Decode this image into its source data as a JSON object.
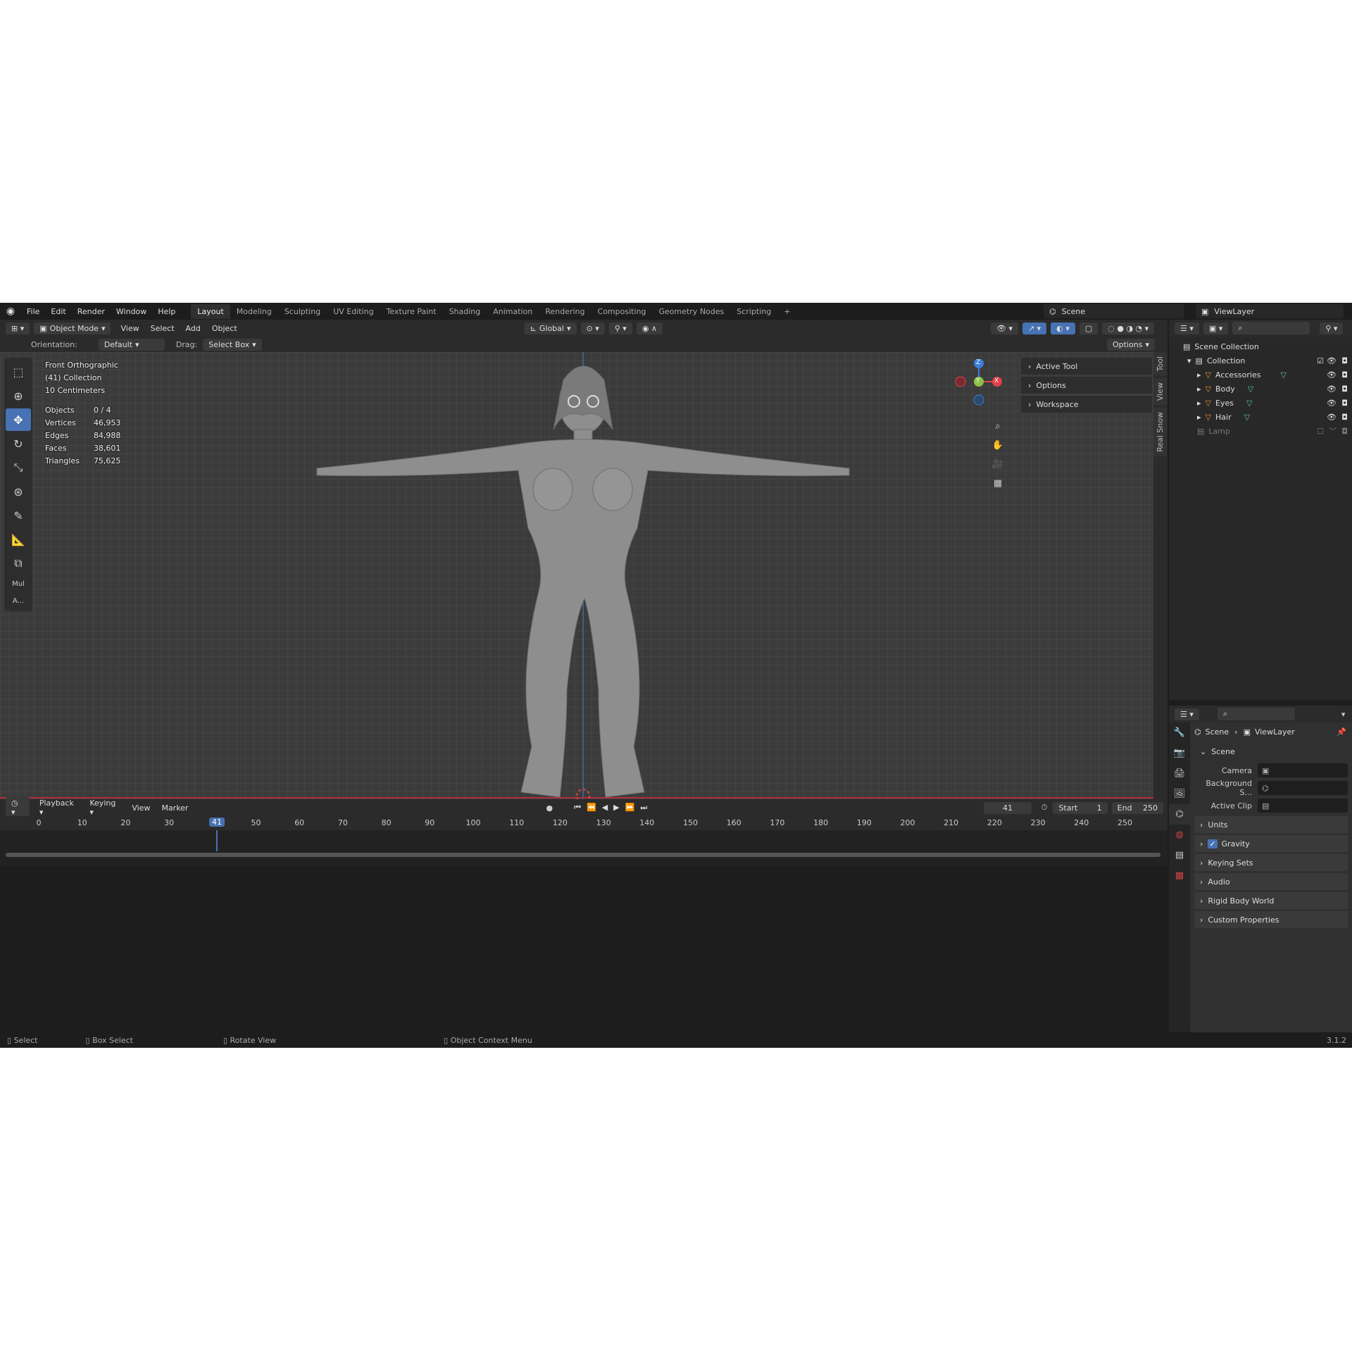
{
  "topbar": {
    "menus": [
      "File",
      "Edit",
      "Render",
      "Window",
      "Help"
    ],
    "workspaces": [
      "Layout",
      "Modeling",
      "Sculpting",
      "UV Editing",
      "Texture Paint",
      "Shading",
      "Animation",
      "Rendering",
      "Compositing",
      "Geometry Nodes",
      "Scripting"
    ],
    "active_workspace": "Layout",
    "add_tab": "+",
    "scene": "Scene",
    "view_layer": "ViewLayer"
  },
  "header": {
    "mode": "Object Mode",
    "menus": [
      "View",
      "Select",
      "Add",
      "Object"
    ],
    "transform_orientation": "Global",
    "orientation_label": "Orientation:",
    "orientation_value": "Default",
    "drag_label": "Drag:",
    "drag_value": "Select Box",
    "options": "Options"
  },
  "viewport": {
    "view_name": "Front Orthographic",
    "collection": "(41) Collection",
    "scale": "10 Centimeters",
    "stats": [
      {
        "label": "Objects",
        "value": "0 / 4"
      },
      {
        "label": "Vertices",
        "value": "46,953"
      },
      {
        "label": "Edges",
        "value": "84,988"
      },
      {
        "label": "Faces",
        "value": "38,601"
      },
      {
        "label": "Triangles",
        "value": "75,625"
      }
    ],
    "tool_extra_1": "Mul",
    "tool_extra_2": "A...",
    "npanel": [
      "Active Tool",
      "Options",
      "Workspace"
    ],
    "side_tabs": [
      "Tool",
      "View",
      "Real Snow"
    ],
    "gizmo": {
      "x": "X",
      "y": "Y",
      "z": "Z"
    }
  },
  "outliner": {
    "scene_collection": "Scene Collection",
    "collection": "Collection",
    "items": [
      "Accessories",
      "Body",
      "Eyes",
      "Hair"
    ],
    "lamp": "Lamp"
  },
  "properties": {
    "breadcrumb_scene": "Scene",
    "breadcrumb_layer": "ViewLayer",
    "section": "Scene",
    "camera_label": "Camera",
    "background_label": "Background S...",
    "clip_label": "Active Clip",
    "panels": [
      "Units",
      "Gravity",
      "Keying Sets",
      "Audio",
      "Rigid Body World",
      "Custom Properties"
    ],
    "gravity_checked": true
  },
  "timeline": {
    "menus": [
      "Playback",
      "Keying",
      "View",
      "Marker"
    ],
    "current_frame": "41",
    "start_label": "Start",
    "start": "1",
    "end_label": "End",
    "end": "250",
    "ticks": [
      "0",
      "10",
      "20",
      "30",
      "50",
      "60",
      "70",
      "80",
      "90",
      "100",
      "110",
      "120",
      "130",
      "140",
      "150",
      "160",
      "170",
      "180",
      "190",
      "200",
      "210",
      "220",
      "230",
      "240",
      "250"
    ]
  },
  "status": {
    "select": "Select",
    "box_select": "Box Select",
    "rotate": "Rotate View",
    "context": "Object Context Menu",
    "version": "3.1.2"
  },
  "colors": {
    "accent": "#4772b3",
    "x_axis": "#e0404a",
    "y_axis": "#8bc34a",
    "z_axis": "#3d7ed8"
  }
}
